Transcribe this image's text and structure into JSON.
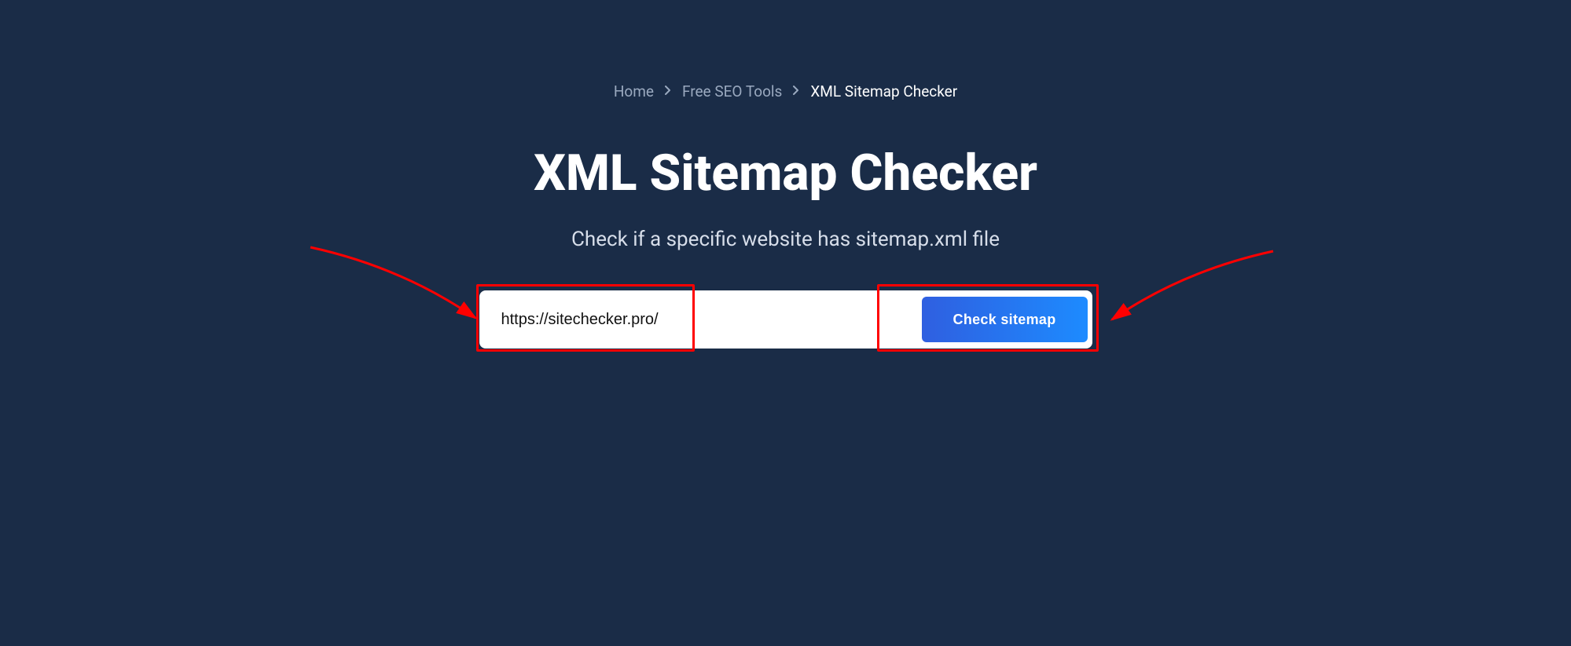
{
  "breadcrumb": {
    "home": "Home",
    "tools": "Free SEO Tools",
    "current": "XML Sitemap Checker"
  },
  "heading": "XML Sitemap Checker",
  "subheading": "Check if a specific website has sitemap.xml file",
  "form": {
    "url_value": "https://sitechecker.pro/",
    "button_label": "Check sitemap"
  }
}
